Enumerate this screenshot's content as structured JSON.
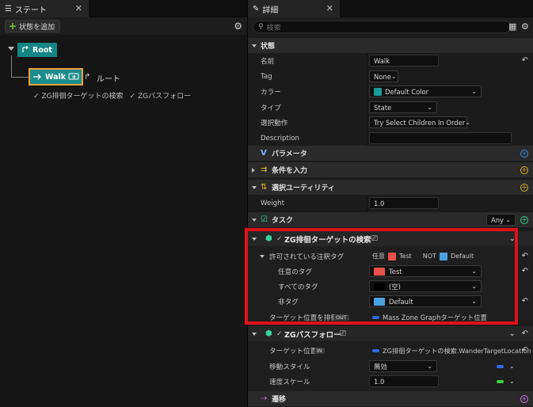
{
  "left_panel": {
    "tab_title": "ステート",
    "add_state_label": "状態を追加",
    "root_label": "Root",
    "walk_label": "Walk",
    "route_label": "ルート",
    "tasks": [
      "ZG排徊ターゲットの検索",
      "ZGパスフォロー"
    ]
  },
  "right_panel": {
    "tab_title": "詳細",
    "search_placeholder": "検索",
    "sections": {
      "state": "状態",
      "params": "パラメータ",
      "enter_conditions": "条件を入力",
      "selection_utility": "選択ユーティリティ",
      "tasks": "タスク",
      "transitions": "遷移"
    },
    "fields": {
      "name_label": "名前",
      "name_value": "Walk",
      "tag_label": "Tag",
      "tag_value": "None",
      "color_label": "カラー",
      "color_value": "Default Color",
      "type_label": "タイプ",
      "type_value": "State",
      "selection_label": "選択動作",
      "selection_value": "Try Select Children In Order",
      "description_label": "Description",
      "weight_label": "Weight",
      "weight_value": "1.0",
      "tasks_filter": "Any"
    },
    "task1": {
      "title": "ZG排徊ターゲットの検索",
      "allowed_tags_label": "許可されている注釈タグ",
      "summary_any": "任意",
      "summary_any_tag": "Test",
      "summary_not": "NOT",
      "summary_not_tag": "Default",
      "any_tag_label": "任意のタグ",
      "any_tag_value": "Test",
      "all_tag_label": "すべてのタグ",
      "all_tag_value": "(空)",
      "not_tag_label": "非タグ",
      "not_tag_value": "Default",
      "output_label": "ターゲット位置を排徊",
      "output_pill": "OUT",
      "output_value": "Mass Zone Graphターゲット位置"
    },
    "task2": {
      "title": "ZGパスフォロー",
      "target_label": "ターゲット位置",
      "target_pill": "IN",
      "target_value": "ZG排徊ターゲットの検索.WanderTargetLocation",
      "move_label": "移動スタイル",
      "move_value": "無効",
      "speed_label": "速度スケール",
      "speed_value": "1.0"
    }
  },
  "colors": {
    "accent_teal": "#168585",
    "selection_orange": "#e9a23a",
    "highlight_red": "#e0111a",
    "test_swatch": "#e8504a",
    "default_swatch": "#4aa0e0",
    "color_swatch": "#1a9a9a"
  }
}
